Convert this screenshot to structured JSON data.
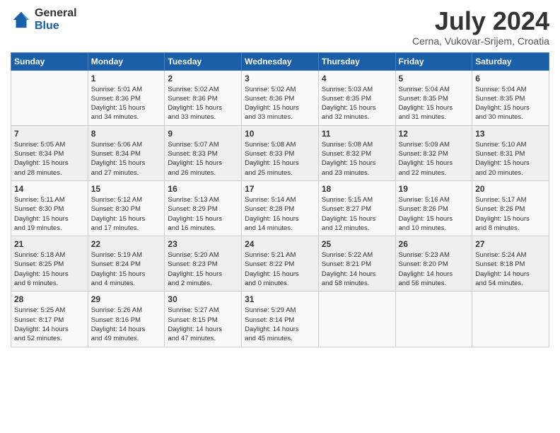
{
  "header": {
    "logo_general": "General",
    "logo_blue": "Blue",
    "month_title": "July 2024",
    "location": "Cerna, Vukovar-Srijem, Croatia"
  },
  "days_of_week": [
    "Sunday",
    "Monday",
    "Tuesday",
    "Wednesday",
    "Thursday",
    "Friday",
    "Saturday"
  ],
  "weeks": [
    [
      {
        "day": "",
        "info": ""
      },
      {
        "day": "1",
        "info": "Sunrise: 5:01 AM\nSunset: 8:36 PM\nDaylight: 15 hours\nand 34 minutes."
      },
      {
        "day": "2",
        "info": "Sunrise: 5:02 AM\nSunset: 8:36 PM\nDaylight: 15 hours\nand 33 minutes."
      },
      {
        "day": "3",
        "info": "Sunrise: 5:02 AM\nSunset: 8:36 PM\nDaylight: 15 hours\nand 33 minutes."
      },
      {
        "day": "4",
        "info": "Sunrise: 5:03 AM\nSunset: 8:35 PM\nDaylight: 15 hours\nand 32 minutes."
      },
      {
        "day": "5",
        "info": "Sunrise: 5:04 AM\nSunset: 8:35 PM\nDaylight: 15 hours\nand 31 minutes."
      },
      {
        "day": "6",
        "info": "Sunrise: 5:04 AM\nSunset: 8:35 PM\nDaylight: 15 hours\nand 30 minutes."
      }
    ],
    [
      {
        "day": "7",
        "info": "Sunrise: 5:05 AM\nSunset: 8:34 PM\nDaylight: 15 hours\nand 28 minutes."
      },
      {
        "day": "8",
        "info": "Sunrise: 5:06 AM\nSunset: 8:34 PM\nDaylight: 15 hours\nand 27 minutes."
      },
      {
        "day": "9",
        "info": "Sunrise: 5:07 AM\nSunset: 8:33 PM\nDaylight: 15 hours\nand 26 minutes."
      },
      {
        "day": "10",
        "info": "Sunrise: 5:08 AM\nSunset: 8:33 PM\nDaylight: 15 hours\nand 25 minutes."
      },
      {
        "day": "11",
        "info": "Sunrise: 5:08 AM\nSunset: 8:32 PM\nDaylight: 15 hours\nand 23 minutes."
      },
      {
        "day": "12",
        "info": "Sunrise: 5:09 AM\nSunset: 8:32 PM\nDaylight: 15 hours\nand 22 minutes."
      },
      {
        "day": "13",
        "info": "Sunrise: 5:10 AM\nSunset: 8:31 PM\nDaylight: 15 hours\nand 20 minutes."
      }
    ],
    [
      {
        "day": "14",
        "info": "Sunrise: 5:11 AM\nSunset: 8:30 PM\nDaylight: 15 hours\nand 19 minutes."
      },
      {
        "day": "15",
        "info": "Sunrise: 5:12 AM\nSunset: 8:30 PM\nDaylight: 15 hours\nand 17 minutes."
      },
      {
        "day": "16",
        "info": "Sunrise: 5:13 AM\nSunset: 8:29 PM\nDaylight: 15 hours\nand 16 minutes."
      },
      {
        "day": "17",
        "info": "Sunrise: 5:14 AM\nSunset: 8:28 PM\nDaylight: 15 hours\nand 14 minutes."
      },
      {
        "day": "18",
        "info": "Sunrise: 5:15 AM\nSunset: 8:27 PM\nDaylight: 15 hours\nand 12 minutes."
      },
      {
        "day": "19",
        "info": "Sunrise: 5:16 AM\nSunset: 8:26 PM\nDaylight: 15 hours\nand 10 minutes."
      },
      {
        "day": "20",
        "info": "Sunrise: 5:17 AM\nSunset: 8:26 PM\nDaylight: 15 hours\nand 8 minutes."
      }
    ],
    [
      {
        "day": "21",
        "info": "Sunrise: 5:18 AM\nSunset: 8:25 PM\nDaylight: 15 hours\nand 6 minutes."
      },
      {
        "day": "22",
        "info": "Sunrise: 5:19 AM\nSunset: 8:24 PM\nDaylight: 15 hours\nand 4 minutes."
      },
      {
        "day": "23",
        "info": "Sunrise: 5:20 AM\nSunset: 8:23 PM\nDaylight: 15 hours\nand 2 minutes."
      },
      {
        "day": "24",
        "info": "Sunrise: 5:21 AM\nSunset: 8:22 PM\nDaylight: 15 hours\nand 0 minutes."
      },
      {
        "day": "25",
        "info": "Sunrise: 5:22 AM\nSunset: 8:21 PM\nDaylight: 14 hours\nand 58 minutes."
      },
      {
        "day": "26",
        "info": "Sunrise: 5:23 AM\nSunset: 8:20 PM\nDaylight: 14 hours\nand 56 minutes."
      },
      {
        "day": "27",
        "info": "Sunrise: 5:24 AM\nSunset: 8:18 PM\nDaylight: 14 hours\nand 54 minutes."
      }
    ],
    [
      {
        "day": "28",
        "info": "Sunrise: 5:25 AM\nSunset: 8:17 PM\nDaylight: 14 hours\nand 52 minutes."
      },
      {
        "day": "29",
        "info": "Sunrise: 5:26 AM\nSunset: 8:16 PM\nDaylight: 14 hours\nand 49 minutes."
      },
      {
        "day": "30",
        "info": "Sunrise: 5:27 AM\nSunset: 8:15 PM\nDaylight: 14 hours\nand 47 minutes."
      },
      {
        "day": "31",
        "info": "Sunrise: 5:29 AM\nSunset: 8:14 PM\nDaylight: 14 hours\nand 45 minutes."
      },
      {
        "day": "",
        "info": ""
      },
      {
        "day": "",
        "info": ""
      },
      {
        "day": "",
        "info": ""
      }
    ]
  ]
}
